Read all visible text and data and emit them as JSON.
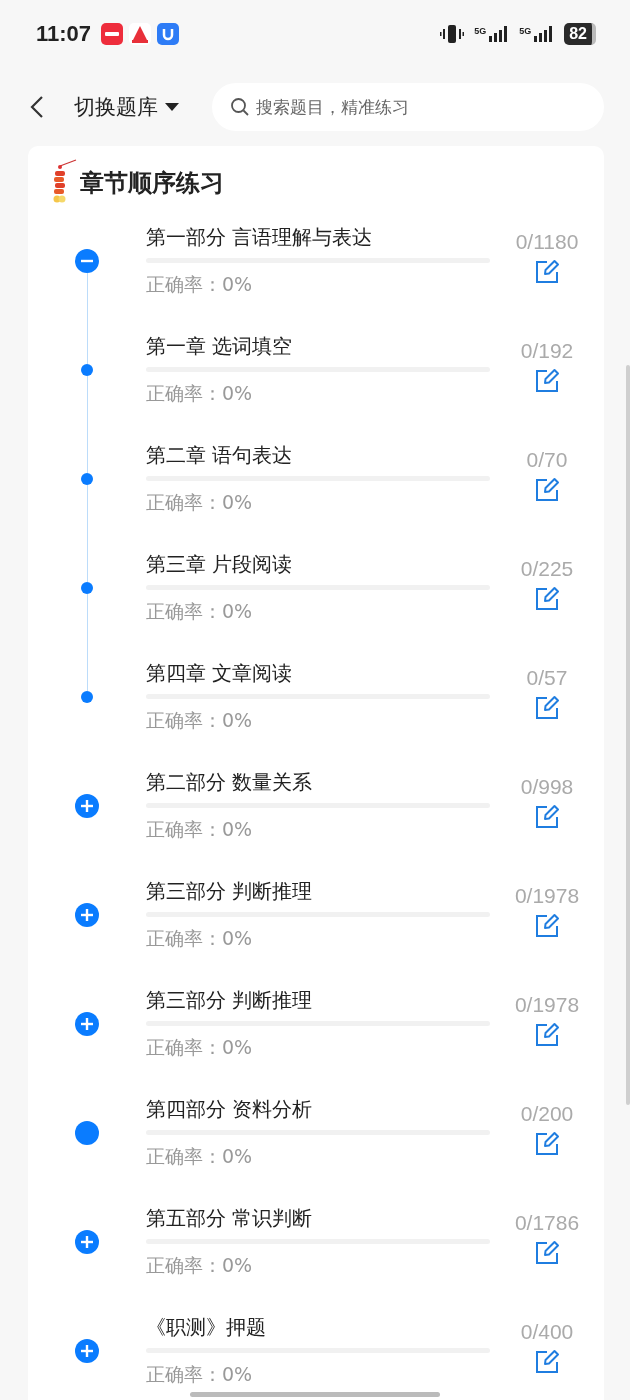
{
  "status_bar": {
    "time": "11:07",
    "network_labels": [
      "5G",
      "5G"
    ],
    "battery": "82"
  },
  "header": {
    "bank_switch": "切换题库",
    "search": {
      "placeholder": "搜索题目，精准练习"
    }
  },
  "section": {
    "title": "章节顺序练习",
    "items": [
      {
        "kind": "group",
        "expanded": true,
        "title": "第一部分 言语理解与表达",
        "level": 0,
        "accuracy": "正确率：0%",
        "count": "0/1180",
        "children": [
          {
            "kind": "chapter",
            "title": "第一章 选词填空",
            "level": 0,
            "accuracy": "正确率：0%",
            "count": "0/192"
          },
          {
            "kind": "chapter",
            "title": "第二章 语句表达",
            "level": 0,
            "accuracy": "正确率：0%",
            "count": "0/70"
          },
          {
            "kind": "chapter",
            "title": "第三章 片段阅读",
            "level": 0,
            "accuracy": "正确率：0%",
            "count": "0/225"
          },
          {
            "kind": "chapter",
            "title": "第四章 文章阅读",
            "level": 0,
            "accuracy": "正确率：0%",
            "count": "0/57"
          }
        ]
      },
      {
        "kind": "group",
        "expanded": false,
        "title": "第二部分 数量关系",
        "level": 0,
        "accuracy": "正确率：0%",
        "count": "0/998"
      },
      {
        "kind": "group",
        "expanded": false,
        "title": "第三部分 判断推理",
        "level": 0,
        "accuracy": "正确率：0%",
        "count": "0/1978"
      },
      {
        "kind": "group",
        "expanded": false,
        "title": "第三部分 判断推理",
        "level": 0,
        "accuracy": "正确率：0%",
        "count": "0/1978"
      },
      {
        "kind": "leaf",
        "title": "第四部分 资料分析",
        "level": 0,
        "accuracy": "正确率：0%",
        "count": "0/200"
      },
      {
        "kind": "group",
        "expanded": false,
        "title": "第五部分 常识判断",
        "level": 0,
        "accuracy": "正确率：0%",
        "count": "0/1786"
      },
      {
        "kind": "group",
        "expanded": false,
        "title": "《职测》押题",
        "level": 0,
        "accuracy": "正确率：0%",
        "count": "0/400"
      }
    ]
  }
}
